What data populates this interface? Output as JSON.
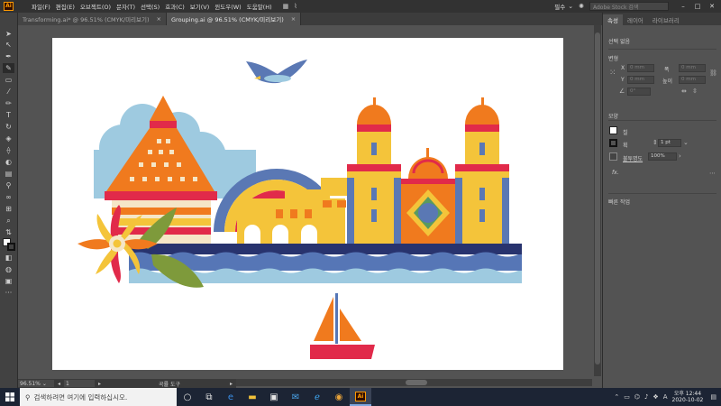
{
  "app": {
    "logo_text": "Ai"
  },
  "menu": {
    "items": [
      "파일(F)",
      "편집(E)",
      "오브젝트(O)",
      "문자(T)",
      "선택(S)",
      "효과(C)",
      "보기(V)",
      "윈도우(W)",
      "도움말(H)"
    ],
    "workspace": "필수",
    "stock_search_placeholder": "Adobe Stock 검색"
  },
  "tabs": [
    {
      "label": "Transforming.ai* @ 96.51% (CMYK/미리보기)",
      "active": false
    },
    {
      "label": "Grouping.ai @ 96.51% (CMYK/미리보기)",
      "active": true
    }
  ],
  "tab_close_glyph": "×",
  "status": {
    "zoom": "96.51%",
    "artboard_number": "1",
    "current_tool": "곡률 도구"
  },
  "panel": {
    "tabs": [
      "속성",
      "레이어",
      "라이브러리"
    ],
    "no_selection": "선택 없음",
    "transform_title": "변형",
    "x_label": "X",
    "y_label": "Y",
    "w_label": "폭",
    "h_label": "높이",
    "field_placeholder": "0 mm",
    "angle_placeholder": "0°",
    "appearance_title": "모양",
    "fill_label": "칠",
    "stroke_label": "획",
    "stroke_weight": "1 pt",
    "opacity_label": "불투명도",
    "opacity_value": "100%",
    "fx_label": "fx.",
    "quick_actions": "빠른 작업"
  },
  "taskbar": {
    "search_placeholder": "검색하려면 여기에 입력하십시오.",
    "ime": "A",
    "time": "오후 12:44",
    "date": "2020-10-02",
    "pinned_icons": [
      "task-view-icon",
      "edge-icon",
      "file-explorer-icon",
      "store-icon",
      "mail-icon",
      "ie-icon",
      "chrome-icon",
      "illustrator-icon"
    ]
  },
  "colors": {
    "accent_orange": "#f07a1e",
    "red": "#e12a4a",
    "yellow": "#f4c43a",
    "navy": "#28336e",
    "blue": "#5676b6",
    "light_blue": "#9ecae0",
    "green": "#7e9a3b",
    "cream": "#f5e6c7"
  }
}
